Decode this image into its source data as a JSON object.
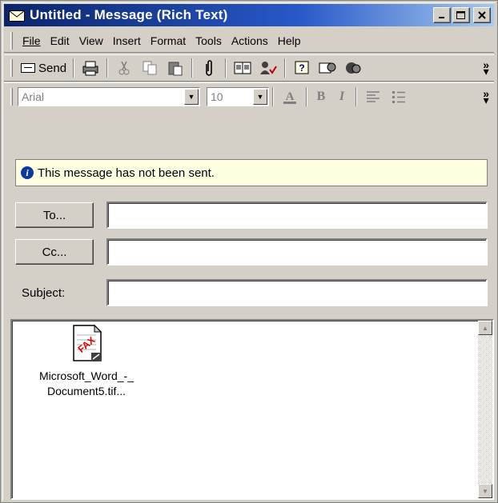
{
  "window": {
    "title": "Untitled - Message (Rich Text)",
    "minimize_label": "_",
    "maximize_label": "□",
    "close_label": "×"
  },
  "menu": {
    "items": [
      "File",
      "Edit",
      "View",
      "Insert",
      "Format",
      "Tools",
      "Actions",
      "Help"
    ]
  },
  "toolbar": {
    "send_label": "Send",
    "icons": [
      "print-icon",
      "cut-icon",
      "copy-icon",
      "paste-icon",
      "attach-icon",
      "address-book-icon",
      "check-names-icon",
      "help-icon",
      "assistant-icon",
      "more-icon"
    ],
    "overflow": "»"
  },
  "format_bar": {
    "font": "Arial",
    "size": "10",
    "bold": "B",
    "italic": "I",
    "overflow": "»"
  },
  "info": {
    "text": "This message has not been sent."
  },
  "fields": {
    "to_label": "To...",
    "cc_label": "Cc...",
    "subject_label": "Subject:",
    "to_value": "",
    "cc_value": "",
    "subject_value": ""
  },
  "attachment": {
    "icon_text": "FAX",
    "name_line1": "Microsoft_Word_-_",
    "name_line2": "Document5.tif..."
  },
  "colors": {
    "title_bar_start": "#0a246a",
    "title_bar_end": "#a6caf0",
    "window_face": "#d4d0c8",
    "info_bar_bg": "#ffffe1"
  }
}
